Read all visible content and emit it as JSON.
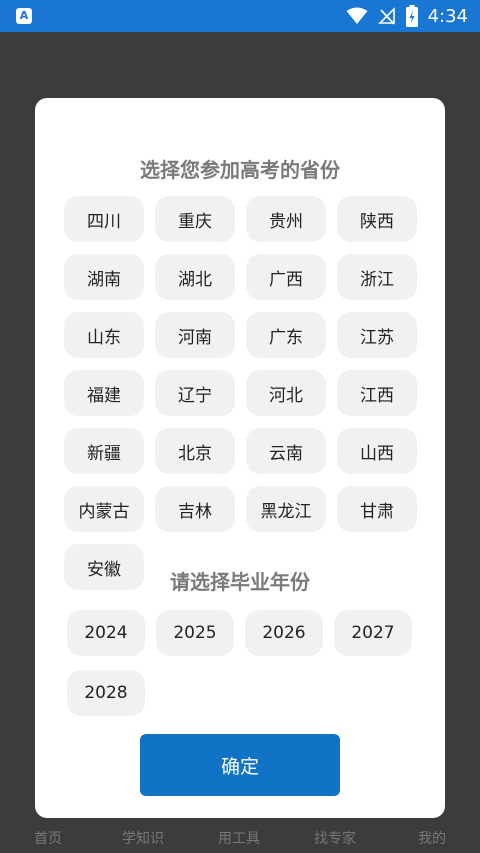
{
  "status_bar": {
    "time": "4:34",
    "app_icon_letter": "A",
    "icons": [
      "wifi-icon",
      "no-signal-icon",
      "battery-charging-icon"
    ]
  },
  "bottom_nav": {
    "items": [
      "首页",
      "学知识",
      "用工具",
      "找专家",
      "我的"
    ]
  },
  "dialog": {
    "province_title": "选择您参加高考的省份",
    "provinces": [
      "四川",
      "重庆",
      "贵州",
      "陕西",
      "湖南",
      "湖北",
      "广西",
      "浙江",
      "山东",
      "河南",
      "广东",
      "江苏",
      "福建",
      "辽宁",
      "河北",
      "江西",
      "新疆",
      "北京",
      "云南",
      "山西",
      "内蒙古",
      "吉林",
      "黑龙江",
      "甘肃",
      "安徽"
    ],
    "year_title": "请选择毕业年份",
    "years": [
      "2024",
      "2025",
      "2026",
      "2027",
      "2028"
    ],
    "confirm_label": "确定"
  },
  "colors": {
    "status_bar": "#1976d2",
    "confirm_button": "#1173c6",
    "chip_background": "#f2f1ef",
    "overlay": "#3c3c3c"
  }
}
